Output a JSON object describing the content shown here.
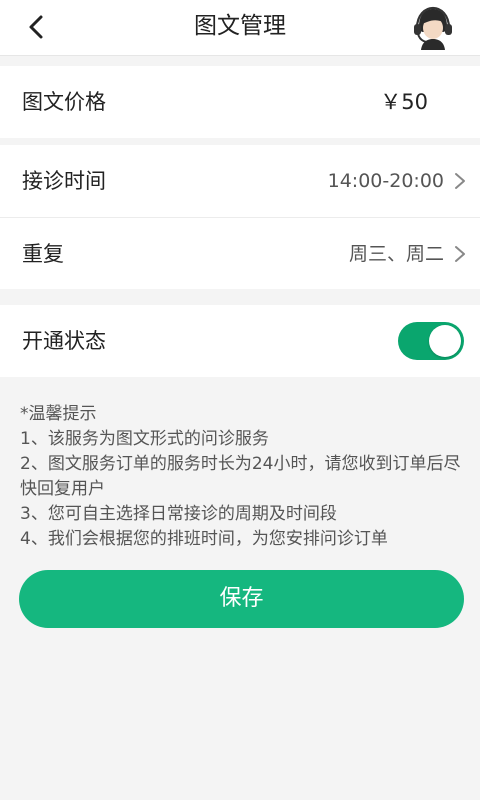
{
  "header": {
    "title": "图文管理",
    "back_icon": "chevron-left-icon",
    "service_icon": "customer-service-headset-icon"
  },
  "price_row": {
    "label": "图文价格",
    "value": "￥50"
  },
  "schedule": {
    "time_label": "接诊时间",
    "time_value": "14:00-20:00",
    "repeat_label": "重复",
    "repeat_value": "周三、周二"
  },
  "status_row": {
    "label": "开通状态",
    "enabled": true
  },
  "tips": {
    "title": "*温馨提示",
    "items": [
      "1、该服务为图文形式的问诊服务",
      "2、图文服务订单的服务时长为24小时，请您收到订单后尽快回复用户",
      "3、您可自主选择日常接诊的周期及时间段",
      "4、我们会根据您的排班时间，为您安排问诊订单"
    ]
  },
  "save_button": {
    "label": "保存"
  },
  "colors": {
    "accent": "#15b77f",
    "toggle_on": "#0aa66e",
    "background": "#f4f4f4"
  }
}
